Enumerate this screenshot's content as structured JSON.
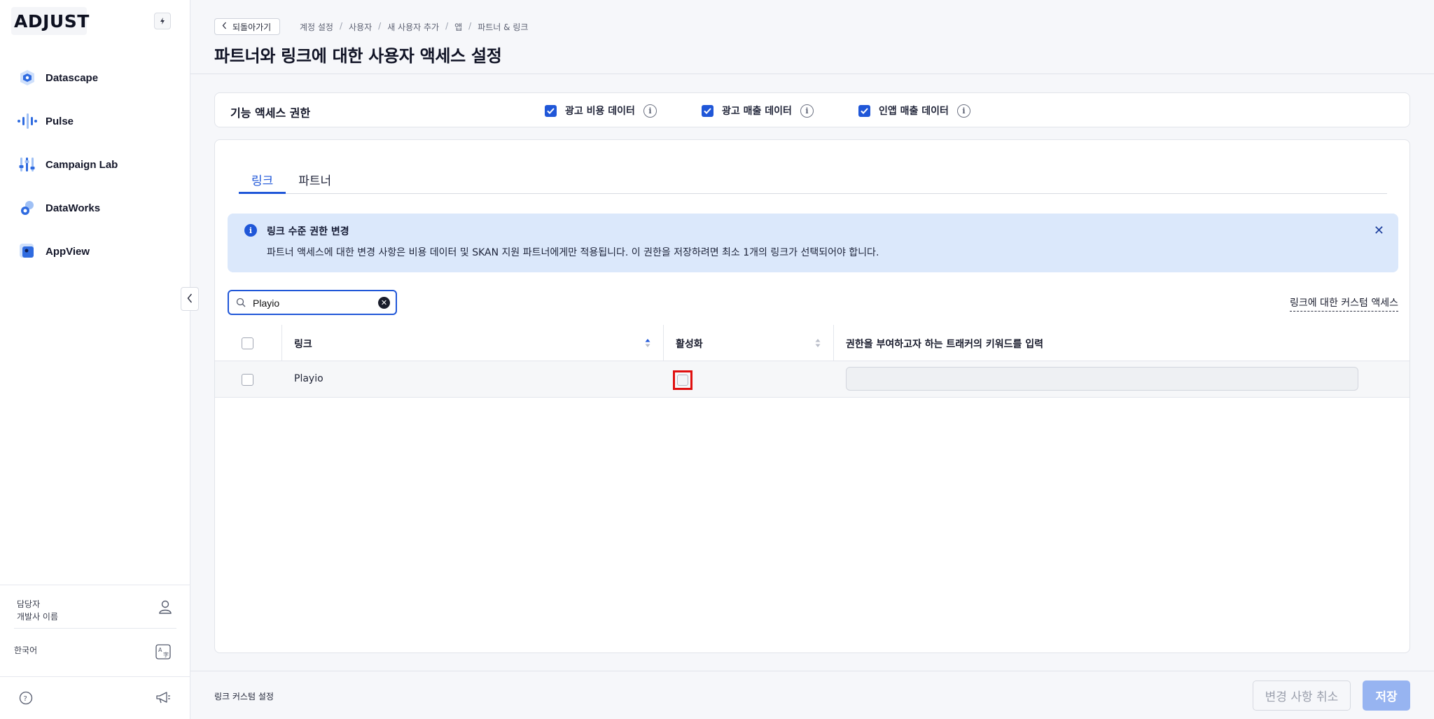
{
  "brand": {
    "logo_text": "ADJUST"
  },
  "sidebar": {
    "items": [
      {
        "label": "Datascape",
        "icon": "datascape-icon"
      },
      {
        "label": "Pulse",
        "icon": "pulse-icon"
      },
      {
        "label": "Campaign Lab",
        "icon": "campaign-lab-icon"
      },
      {
        "label": "DataWorks",
        "icon": "dataworks-icon"
      },
      {
        "label": "AppView",
        "icon": "appview-icon"
      }
    ],
    "user": {
      "role": "담당자",
      "org": "개발사 이름"
    },
    "language": "한국어"
  },
  "header": {
    "back_label": "되돌아가기",
    "breadcrumbs": [
      "계정 설정",
      "사용자",
      "새 사용자 추가",
      "앱",
      "파트너 & 링크"
    ],
    "title": "파트너와 링크에 대한 사용자 액세스 설정"
  },
  "feature_access": {
    "title": "기능 액세스 권한",
    "options": [
      {
        "label": "광고 비용 데이터",
        "checked": true
      },
      {
        "label": "광고 매출 데이터",
        "checked": true
      },
      {
        "label": "인앱 매출 데이터",
        "checked": true
      }
    ]
  },
  "tabs": [
    {
      "label": "링크",
      "active": true
    },
    {
      "label": "파트너",
      "active": false
    }
  ],
  "banner": {
    "title": "링크 수준 권한 변경",
    "body": "파트너 액세스에 대한 변경 사항은 비용 데이터 및 SKAN 지원 파트너에게만 적용됩니다. 이 권한을 저장하려면 최소 1개의 링크가 선택되어야 합니다."
  },
  "search": {
    "value": "Playio"
  },
  "custom_access_link": "링크에 대한 커스텀 액세스",
  "table": {
    "columns": [
      "링크",
      "활성화",
      "권한을 부여하고자 하는 트래커의 키워드를 입력"
    ],
    "rows": [
      {
        "link": "Playio",
        "selected": false,
        "active": false,
        "keyword": ""
      }
    ]
  },
  "footer": {
    "label": "링크 커스텀 설정",
    "cancel_label": "변경 사항 취소",
    "save_label": "저장"
  },
  "colors": {
    "accent": "#2057d8",
    "banner_bg": "#dbe8fb",
    "save_disabled": "#97b4f1",
    "highlight": "#e01010"
  }
}
